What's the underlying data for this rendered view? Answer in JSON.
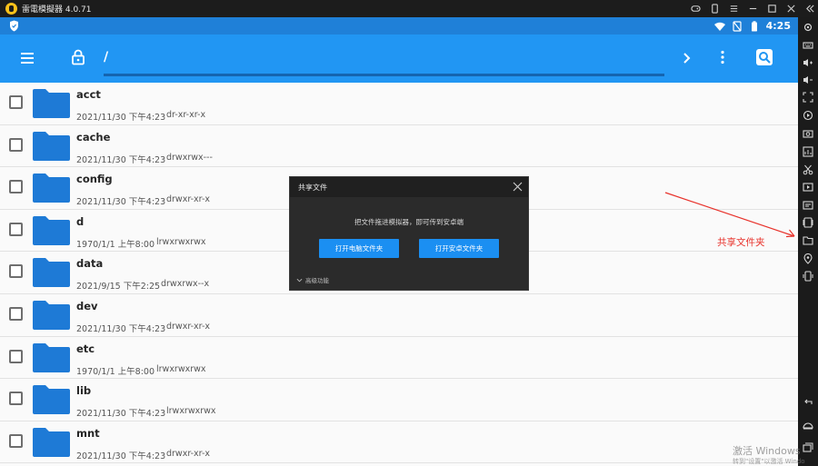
{
  "emulator": {
    "title": "雷電模擬器 4.0.71"
  },
  "statusbar": {
    "time": "4:25"
  },
  "appbar": {
    "path": "/"
  },
  "files": [
    {
      "name": "acct",
      "date": "2021/11/30 下午4:23",
      "perm": "dr-xr-xr-x"
    },
    {
      "name": "cache",
      "date": "2021/11/30 下午4:23",
      "perm": "drwxrwx---"
    },
    {
      "name": "config",
      "date": "2021/11/30 下午4:23",
      "perm": "drwxr-xr-x"
    },
    {
      "name": "d",
      "date": "1970/1/1 上午8:00",
      "perm": "lrwxrwxrwx"
    },
    {
      "name": "data",
      "date": "2021/9/15 下午2:25",
      "perm": "drwxrwx--x"
    },
    {
      "name": "dev",
      "date": "2021/11/30 下午4:23",
      "perm": "drwxr-xr-x"
    },
    {
      "name": "etc",
      "date": "1970/1/1 上午8:00",
      "perm": "lrwxrwxrwx"
    },
    {
      "name": "lib",
      "date": "2021/11/30 下午4:23",
      "perm": "lrwxrwxrwx"
    },
    {
      "name": "mnt",
      "date": "2021/11/30 下午4:23",
      "perm": "drwxr-xr-x"
    }
  ],
  "dialog": {
    "title": "共享文件",
    "message": "把文件拖进模拟器，即可传到安卓端",
    "btn_pc": "打开电脑文件夹",
    "btn_android": "打开安卓文件夹",
    "advanced": "高级功能"
  },
  "annotation": {
    "label": "共享文件夹"
  },
  "watermark": {
    "line1": "激活 Windows",
    "line2": "转到\"设置\"以激活 Windo"
  },
  "colors": {
    "appbar": "#2196f3",
    "statusbar": "#1f80d8",
    "folder": "#1e7ad6",
    "dialog_button": "#1b8ff2",
    "annotation": "#e8322b"
  }
}
